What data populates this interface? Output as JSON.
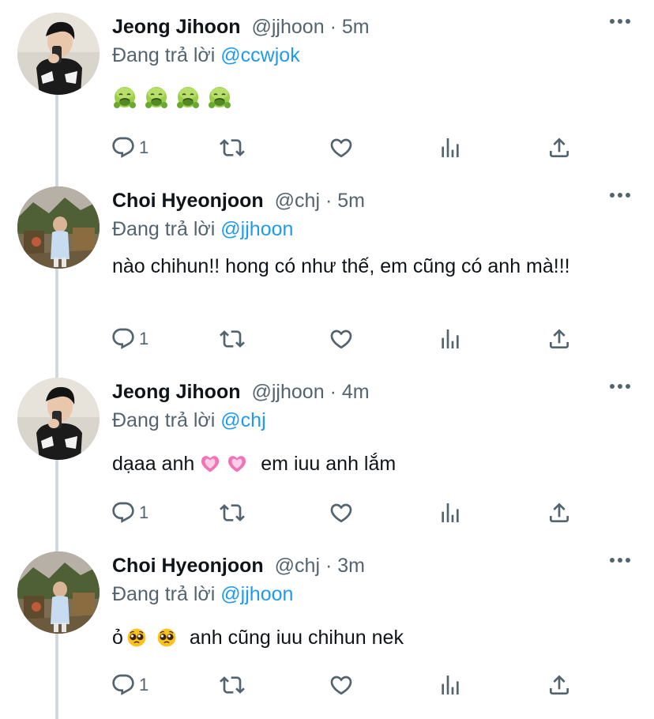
{
  "tweets": [
    {
      "name": "Jeong Jihoon",
      "handle": "@jjhoon",
      "separator": "·",
      "time": "5m",
      "replying_prefix": "Đang trả lời",
      "replying_to": "@ccwjok",
      "text": "",
      "emojis": [
        "nauseated-face",
        "nauseated-face",
        "nauseated-face",
        "nauseated-face"
      ],
      "reply_count": "1"
    },
    {
      "name": "Choi Hyeonjoon",
      "handle": "@chj",
      "separator": "·",
      "time": "5m",
      "replying_prefix": "Đang trả lời",
      "replying_to": "@jjhoon",
      "text": "nào chihun!! hong có như thế, em cũng có anh mà!!!",
      "reply_count": "1"
    },
    {
      "name": "Jeong Jihoon",
      "handle": "@jjhoon",
      "separator": "·",
      "time": "4m",
      "replying_prefix": "Đang trả lời",
      "replying_to": "@chj",
      "text_before": "dạaa anh",
      "text_after": "em iuu anh lắm",
      "emojis": [
        "growing-heart",
        "growing-heart"
      ],
      "reply_count": "1"
    },
    {
      "name": "Choi Hyeonjoon",
      "handle": "@chj",
      "separator": "·",
      "time": "3m",
      "replying_prefix": "Đang trả lời",
      "replying_to": "@jjhoon",
      "text_before": "ỏ",
      "text_after": "anh cũng iuu chihun nek",
      "emojis": [
        "pleading-face",
        "pleading-face"
      ],
      "reply_count": "1"
    }
  ],
  "icons": {
    "reply": "reply-icon",
    "retweet": "retweet-icon",
    "like": "like-icon",
    "views": "views-icon",
    "share": "share-icon",
    "more": "more-icon"
  },
  "colors": {
    "link": "#1d9bf0",
    "muted": "#536471",
    "thread_line": "#cfd9de"
  }
}
